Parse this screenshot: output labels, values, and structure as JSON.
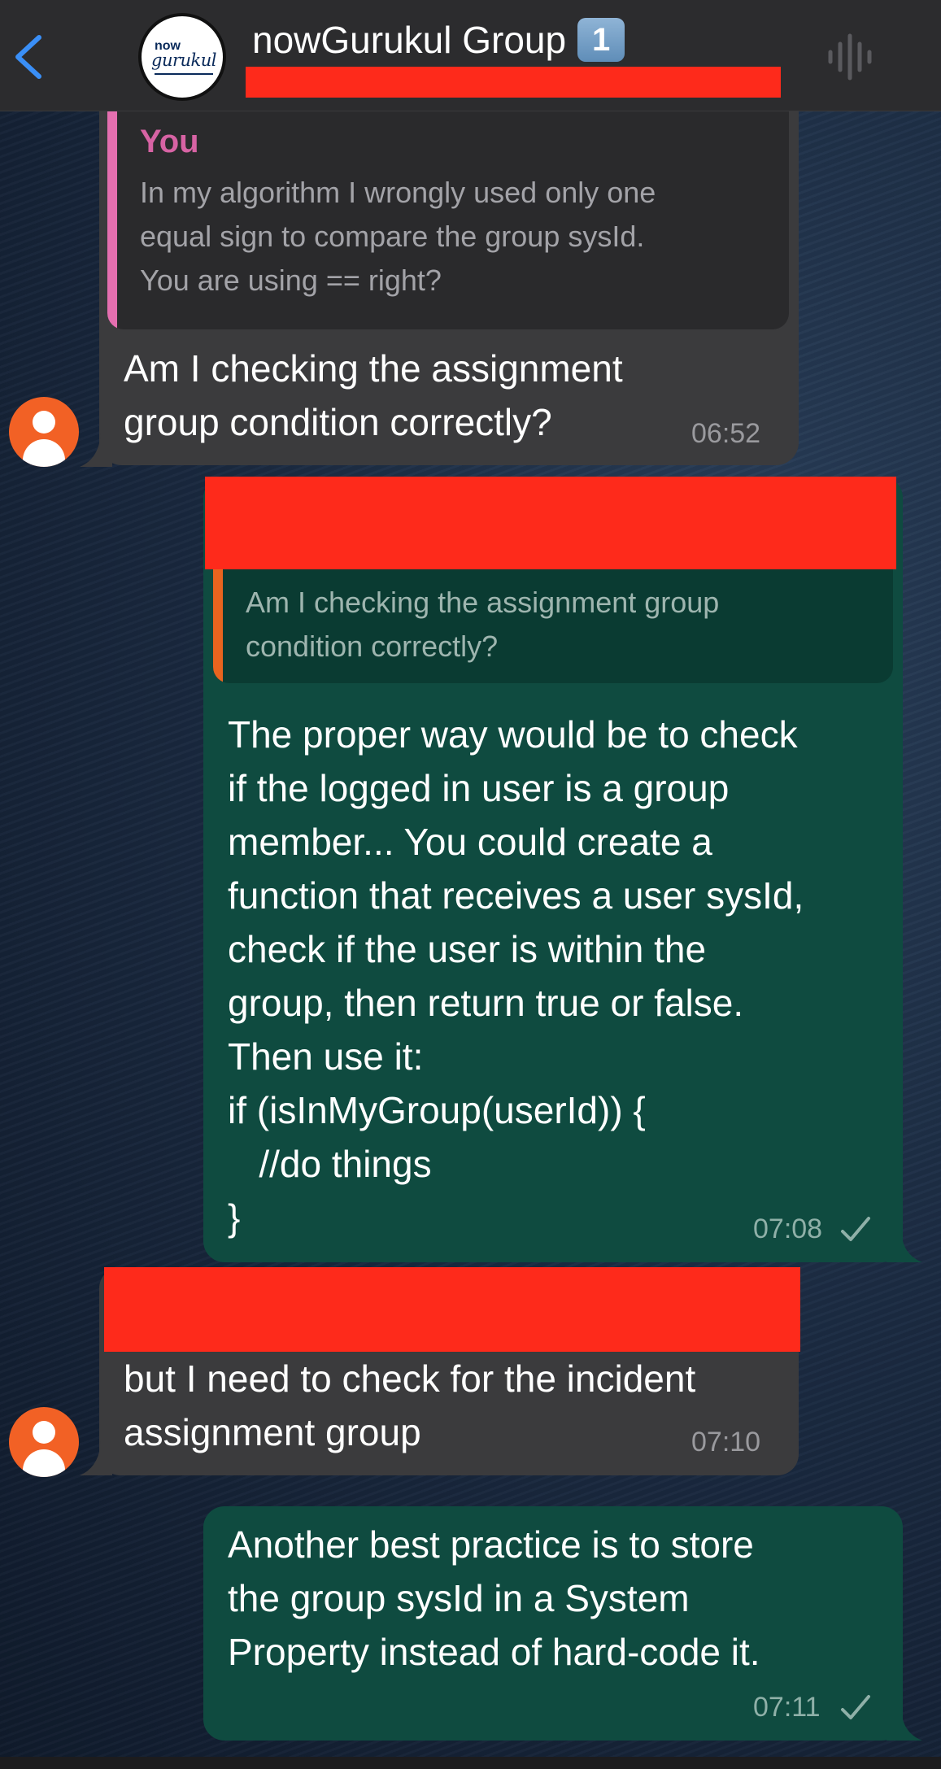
{
  "header": {
    "title": "nowGurukul Group",
    "badge": "1",
    "logo_now": "now",
    "logo_text": "gurukul"
  },
  "messages": [
    {
      "direction": "incoming",
      "quote": {
        "author": "You",
        "text": "In my algorithm I wrongly used only one\nequal sign to compare the group sysId.\nYou are using == right?"
      },
      "text": "Am I checking the assignment\ngroup condition correctly?",
      "time": "06:52"
    },
    {
      "direction": "outgoing",
      "quote": {
        "text": "Am I checking the assignment group\ncondition correctly?"
      },
      "text": "The proper way would be to check\nif the logged in user is a group\nmember... You could create a\nfunction that receives a user sysId,\ncheck if the user is within the\ngroup, then return true or false.\nThen use it:\nif (isInMyGroup(userId)) {\n   //do things\n}",
      "time": "07:08",
      "status": "sent"
    },
    {
      "direction": "incoming",
      "text": "but I need to check for the incident\nassignment group",
      "time": "07:10"
    },
    {
      "direction": "outgoing",
      "text": "Another best practice is to store\nthe group sysId in a System\nProperty instead of hard-code it.",
      "time": "07:11",
      "status": "sent"
    }
  ],
  "colors": {
    "header_bg": "#2c2c2e",
    "incoming_bubble": "#3b3b3d",
    "outgoing_bubble": "#0f4b40",
    "accent_blue": "#3a8ff7",
    "redaction": "#fe2a1b",
    "quote_author": "#d763a4",
    "avatar_orange": "#f26125"
  },
  "icons": [
    "back-chevron-icon",
    "audio-waveform-icon",
    "user-placeholder-icon",
    "checkmark-icon"
  ]
}
